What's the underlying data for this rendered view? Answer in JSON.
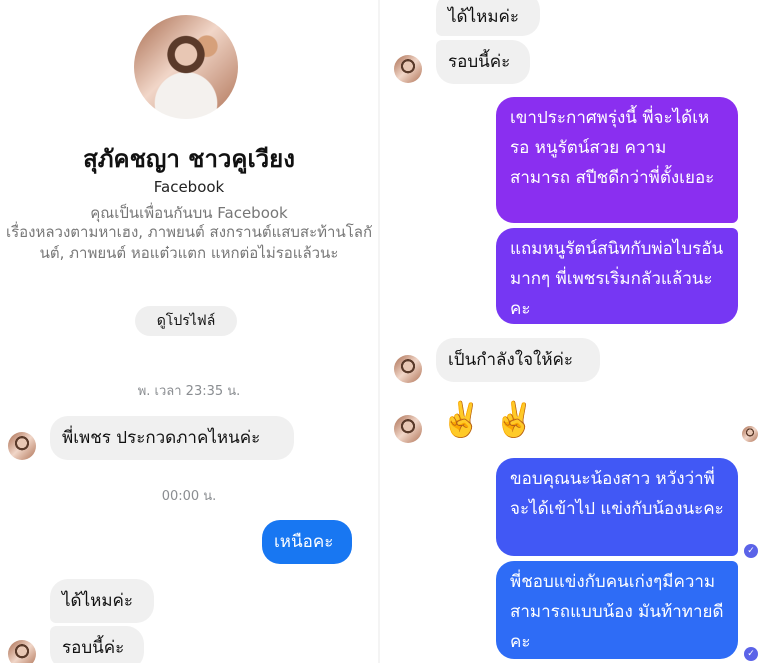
{
  "colors": {
    "incoming_bubble": "#f0f0f0",
    "outgoing_purple": "#8a2ff0",
    "outgoing_blue": "#1877f2",
    "muted_text": "#8a8d91"
  },
  "left": {
    "profile": {
      "name": "สุภัคชญา ชาวคูเวียง",
      "platform": "Facebook",
      "friend_status": "คุณเป็นเพื่อนกันบน Facebook",
      "description": "เรื่องหลวงตามหาเฮง, ภาพยนต์ สงกรานต์แสบสะท้านโลกันต์, ภาพยนต์ หอแต๋วแตก แหกต่อไม่รอแล้วนะ",
      "view_profile_label": "ดูโปรไฟล์"
    },
    "timestamps": [
      "พ. เวลา 23:35 น.",
      "00:00 น."
    ],
    "messages": [
      {
        "text": "พี่เพชร ประกวดภาคไหนค่ะ"
      },
      {
        "text": "เหนือคะ"
      },
      {
        "text": "ได้ไหมค่ะ"
      },
      {
        "text": "รอบนี้ค่ะ"
      }
    ]
  },
  "right": {
    "messages": [
      {
        "text": "ได้ไหมค่ะ"
      },
      {
        "text": "รอบนี้ค่ะ"
      },
      {
        "text": "เขาประกาศพรุ่งนี้ พี่จะได้เหรอ หนูรัตน์สวย ความสามารถ สปีชดีกว่าพี่ตั้งเยอะ"
      },
      {
        "text": "แถมหนูรัตน์สนิทกับพ่อไบรอันมากๆ พี่เพชรเริ่มกลัวแล้วนะคะ"
      },
      {
        "text": "เป็นกำลังใจให้ค่ะ"
      },
      {
        "text": "✌️ ✌️"
      },
      {
        "text": "ขอบคุณนะน้องสาว หวังว่าพี่จะได้เข้าไป แข่งกับน้องนะคะ"
      },
      {
        "text": "พี่ชอบแข่งกับคนเก่งๆมีความสามารถแบบน้อง มันท้าทายดีคะ"
      }
    ]
  }
}
